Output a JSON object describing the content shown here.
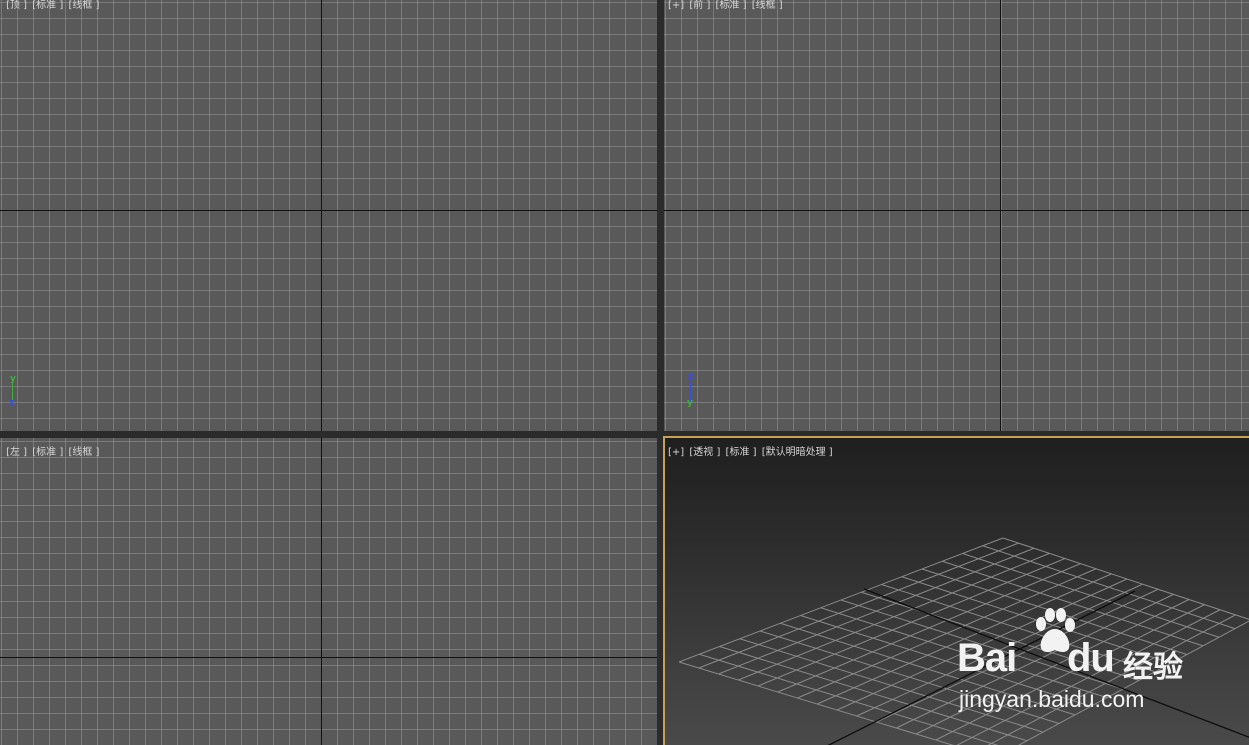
{
  "viewports": {
    "top": {
      "label": [
        " ]",
        "[顶 ]",
        "[标准 ]",
        "[线框 ]"
      ],
      "gizmo": {
        "y": "y",
        "z": "z",
        "x": "x"
      }
    },
    "front": {
      "label": [
        "[+]",
        "[前 ]",
        "[标准 ]",
        "[线框 ]"
      ],
      "gizmo": {
        "z": "z",
        "y": "y",
        "x": "x"
      }
    },
    "left": {
      "label": [
        " ]",
        "[左 ]",
        "[标准 ]",
        "[线框 ]"
      ]
    },
    "perspective": {
      "label": [
        "[+]",
        "[透视 ]",
        "[标准 ]",
        "[默认明暗处理 ]"
      ],
      "active": true
    }
  },
  "watermark": {
    "bai": "Bai",
    "du": "du",
    "jingyan": "经验",
    "url": "jingyan.baidu.com"
  },
  "colors": {
    "active_border": "#c7a253",
    "grid_bg": "#595959",
    "axis_x": "#c03030",
    "axis_y": "#3fb03f",
    "axis_z": "#3a4fd8"
  }
}
